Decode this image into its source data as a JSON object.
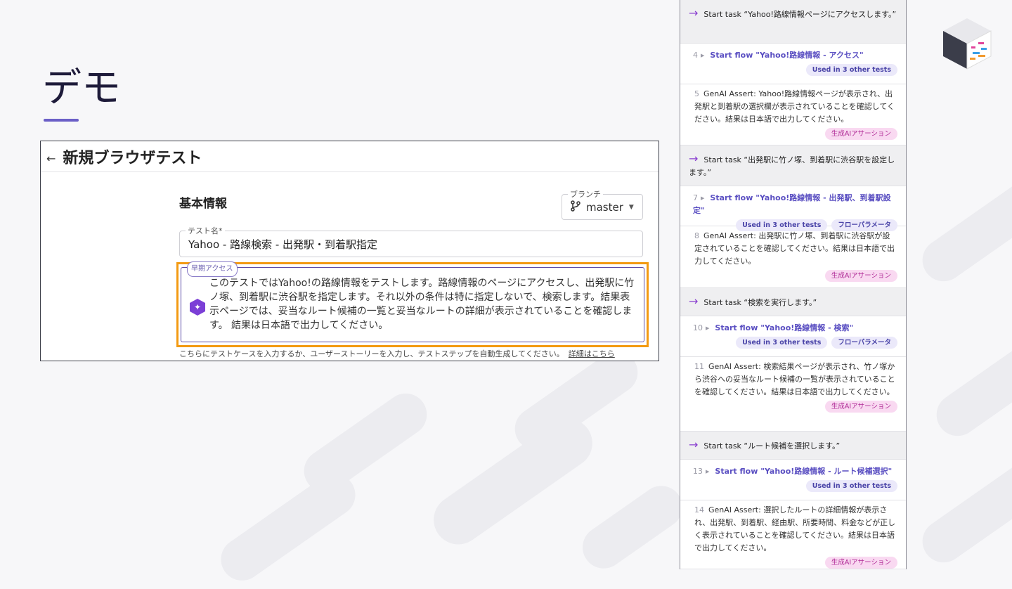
{
  "slide": {
    "title": "デモ"
  },
  "screenshot": {
    "header_title": "新規ブラウザテスト",
    "section_title": "基本情報",
    "branch": {
      "label": "ブランチ",
      "value": "master"
    },
    "test_name": {
      "label": "テスト名*",
      "value": "Yahoo - 路線検索 - 出発駅・到着駅指定"
    },
    "ai_field": {
      "badge": "早期アクセス",
      "value": "このテストではYahoo!の路線情報をテストします。路線情報のページにアクセスし、出発駅に竹ノ塚、到着駅に渋谷駅を指定します。それ以外の条件は特に指定しないで、検索します。結果表示ページでは、妥当なルート候補の一覧と妥当なルートの詳細が表示されていることを確認します。 結果は日本語で出力してください。"
    },
    "hint": "こちらにテストケースを入力するか、ユーザーストーリーを入力し、テストステップを自動生成してください。",
    "hint_link": "詳細はこちら"
  },
  "steps": [
    {
      "type": "task",
      "text": "Start task “Yahoo!路線情報ページにアクセスします。”"
    },
    {
      "type": "flow",
      "num": "4",
      "text": "Start flow \"Yahoo!路線情報 - アクセス\"",
      "tags": [
        "Used in 3 other tests"
      ]
    },
    {
      "type": "assert",
      "num": "5",
      "text": "GenAI Assert: Yahoo!路線情報ページが表示され、出発駅と到着駅の選択欄が表示されていることを確認してください。結果は日本語で出力してください。",
      "tag": "生成AIアサーション"
    },
    {
      "type": "task",
      "text": "Start task “出発駅に竹ノ塚、到着駅に渋谷駅を設定します。”"
    },
    {
      "type": "flow",
      "num": "7",
      "text": "Start flow \"Yahoo!路線情報 - 出発駅、到着駅設定\"",
      "tags": [
        "Used in 3 other tests",
        "フローパラメータ"
      ]
    },
    {
      "type": "assert",
      "num": "8",
      "text": "GenAI Assert: 出発駅に竹ノ塚、到着駅に渋谷駅が設定されていることを確認してください。結果は日本語で出力してください。",
      "tag": "生成AIアサーション"
    },
    {
      "type": "task",
      "text": "Start task “検索を実行します。”"
    },
    {
      "type": "flow",
      "num": "10",
      "text": "Start flow \"Yahoo!路線情報 - 検索\"",
      "tags": [
        "Used in 3 other tests",
        "フローパラメータ"
      ]
    },
    {
      "type": "assert",
      "num": "11",
      "text": "GenAI Assert: 検索結果ページが表示され、竹ノ塚から渋谷への妥当なルート候補の一覧が表示されていることを確認してください。結果は日本語で出力してください。",
      "tag": "生成AIアサーション"
    },
    {
      "type": "task",
      "text": "Start task “ルート候補を選択します。”"
    },
    {
      "type": "flow",
      "num": "13",
      "text": "Start flow \"Yahoo!路線情報 - ルート候補選択\"",
      "tags": [
        "Used in 3 other tests"
      ]
    },
    {
      "type": "assert",
      "num": "14",
      "text": "GenAI Assert: 選択したルートの詳細情報が表示され、出発駅、到着駅、経由駅、所要時間、料金などが正しく表示されていることを確認してください。結果は日本語で出力してください。",
      "tag": "生成AIアサーション"
    }
  ]
}
